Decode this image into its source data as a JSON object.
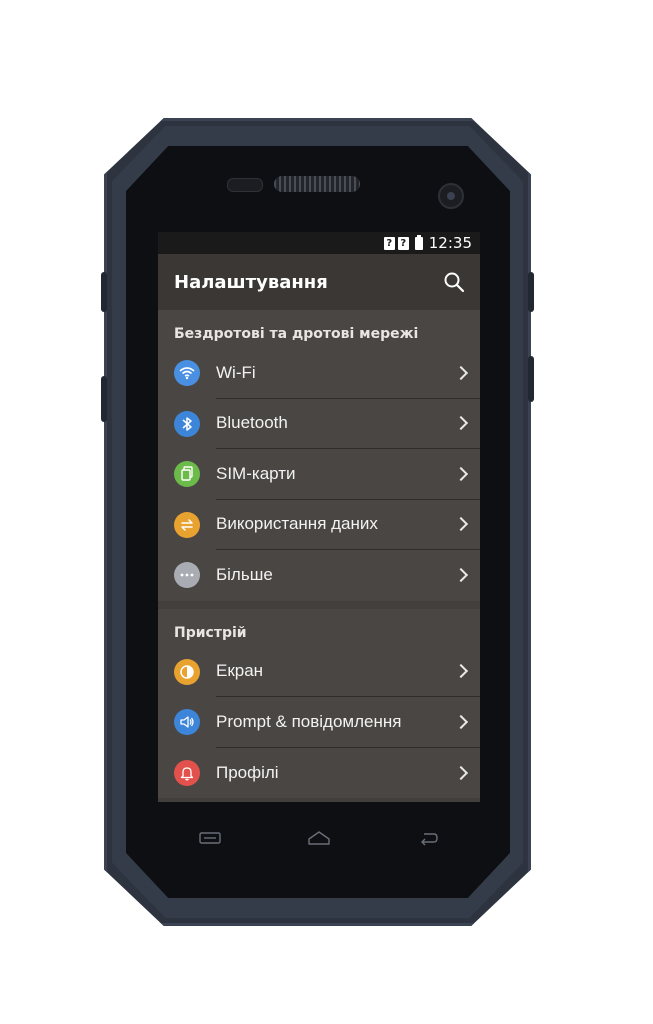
{
  "status_bar": {
    "sim1": "?",
    "sim2": "?",
    "time": "12:35"
  },
  "toolbar": {
    "title": "Налаштування",
    "search_icon": "search-icon"
  },
  "sections": [
    {
      "header": "Бездротові та дротові мережі",
      "items": [
        {
          "label": "Wi-Fi",
          "icon": "wifi-icon",
          "color": "#4a90e2"
        },
        {
          "label": "Bluetooth",
          "icon": "bluetooth-icon",
          "color": "#3d85d8"
        },
        {
          "label": "SIM-карти",
          "icon": "sim-card-icon",
          "color": "#6cbb4a"
        },
        {
          "label": "Використання даних",
          "icon": "data-usage-icon",
          "color": "#e8a22f"
        },
        {
          "label": "Більше",
          "icon": "more-icon",
          "color": "#a9adb3"
        }
      ]
    },
    {
      "header": "Пристрій",
      "items": [
        {
          "label": "Екран",
          "icon": "display-icon",
          "color": "#e8a22f"
        },
        {
          "label": "Prompt & повідомлення",
          "icon": "sound-icon",
          "color": "#3d85d8"
        },
        {
          "label": "Профілі",
          "icon": "bell-icon",
          "color": "#e2514b"
        }
      ]
    }
  ],
  "colors": {
    "screen_bg": "#433f3c",
    "toolbar_bg": "#3a3735",
    "status_bar_bg": "#1a1a1a",
    "phone_body": "#2d3440"
  },
  "nav_keys": [
    "menu-key-icon",
    "home-key-icon",
    "back-key-icon"
  ]
}
